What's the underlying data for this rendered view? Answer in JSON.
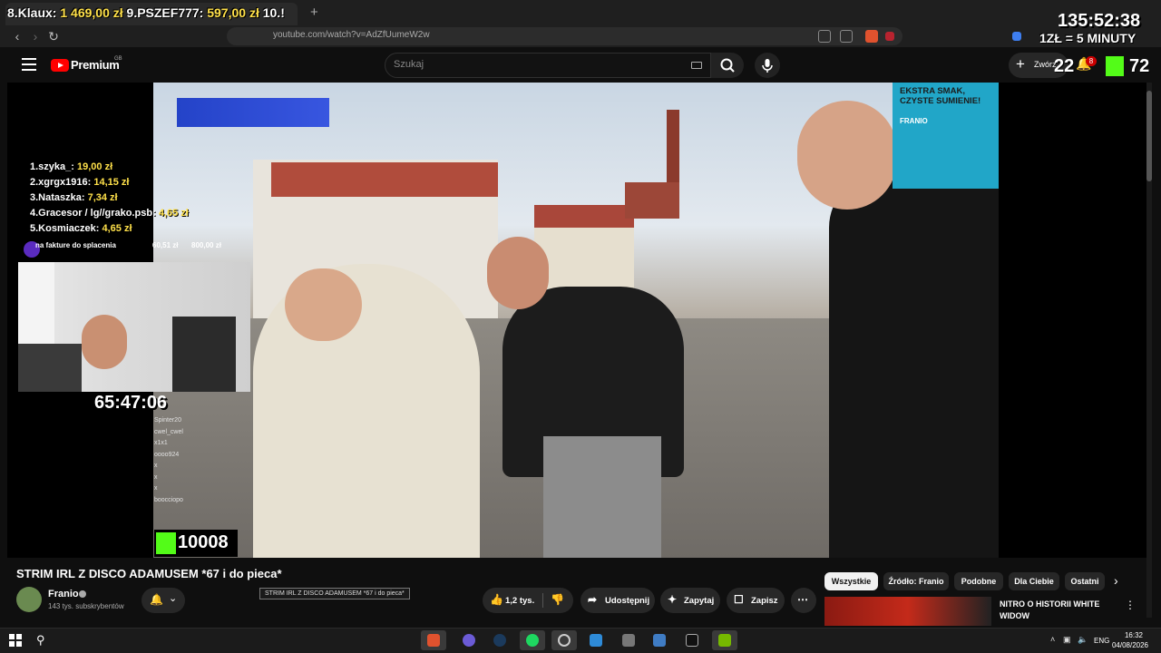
{
  "browser": {
    "new_tab_symbol": "+",
    "url": "youtube.com/watch?v=AdZfUumeW2w"
  },
  "overlay": {
    "donation_1_prefix": "8.Klaux: ",
    "donation_1_amount": "1 469,00 zł",
    "donation_2_prefix": " 9.PSZEF777: ",
    "donation_2_amount": "597,00 zł",
    "donation_3_prefix": " 10.!",
    "timer_right": "135:52:38",
    "rate": "1ZŁ = 5 MINUTY",
    "stat_left": "22",
    "stat_right": "72",
    "timer_left": "65:47:06",
    "kick_count": "10008",
    "leaderboard": [
      {
        "name": "1.szyka_: ",
        "amount": "19,00 zł"
      },
      {
        "name": "2.xgrgx1916: ",
        "amount": "14,15 zł"
      },
      {
        "name": "3.Nataszka: ",
        "amount": "7,34 zł"
      },
      {
        "name": "4.Gracesor / lg//grako.psb: ",
        "amount": "4,65 zł"
      },
      {
        "name": "5.Kosmiaczek: ",
        "amount": "4,65 zł"
      }
    ],
    "goal_label": "na fakture do splacenia",
    "goal_current": "60,51 zł",
    "goal_target": "800,00 zł",
    "chat_lines": [
      "Spinter20",
      "cwel_cwel",
      "x1x1",
      "oooo924",
      "x",
      "x",
      "x",
      "boocciopo"
    ],
    "ad_title": "EKSTRA SMAK, CZYSTE SUMIENIE!",
    "ad_brand": "FRANIO",
    "create_label": "Zwórz",
    "notif_count": "8"
  },
  "youtube": {
    "logo_text": "Premium",
    "region": "GB",
    "search_placeholder": "Szukaj",
    "video_title": "STRIM IRL Z DISCO ADAMUSEM *67 i do pieca*",
    "tooltip": "STRIM IRL Z DISCO ADAMUSEM *67 i do pieca*",
    "channel_name": "Franio",
    "subscribers": "143 tys. subskrybentów",
    "like_count": "1,2 tys.",
    "share_label": "Udostępnij",
    "ask_label": "Zapytaj",
    "save_label": "Zapisz",
    "chips": [
      "Wszystkie",
      "Źródło: Franio",
      "Podobne",
      "Dla Ciebie",
      "Ostatni"
    ],
    "related_title": "NITRO O HISTORII WHITE WIDOW"
  },
  "taskbar": {
    "lang": "ENG",
    "time": "16:32",
    "date": "04/08/2026"
  },
  "colors": {
    "accent_yellow": "#ffe14a",
    "kick_green": "#53fc18",
    "youtube_red": "#ff0000"
  }
}
